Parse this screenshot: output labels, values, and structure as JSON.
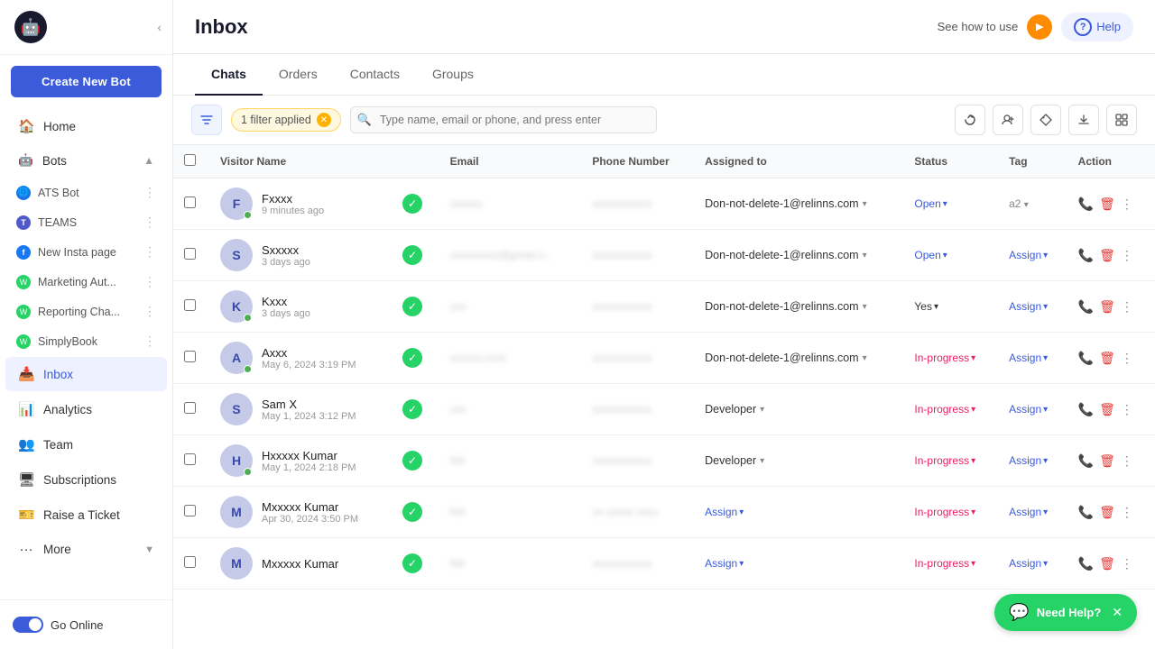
{
  "sidebar": {
    "logo_char": "🤖",
    "create_bot_label": "Create New Bot",
    "nav_items": [
      {
        "id": "home",
        "label": "Home",
        "icon": "🏠"
      },
      {
        "id": "bots",
        "label": "Bots",
        "icon": "🤖",
        "expandable": true
      },
      {
        "id": "inbox",
        "label": "Inbox",
        "icon": "📥",
        "active": true
      },
      {
        "id": "analytics",
        "label": "Analytics",
        "icon": "📊"
      },
      {
        "id": "team",
        "label": "Team",
        "icon": "👥"
      },
      {
        "id": "subscriptions",
        "label": "Subscriptions",
        "icon": "🖥"
      },
      {
        "id": "raise-ticket",
        "label": "Raise a Ticket",
        "icon": "🎫"
      },
      {
        "id": "more",
        "label": "More",
        "icon": "···"
      }
    ],
    "bots": [
      {
        "name": "ATS Bot",
        "badge_type": "blue",
        "badge_char": "🌐"
      },
      {
        "name": "TEAMS",
        "badge_type": "teams",
        "badge_char": "T"
      },
      {
        "name": "New Insta page",
        "badge_type": "fb",
        "badge_char": "f"
      },
      {
        "name": "Marketing Aut...",
        "badge_type": "wa",
        "badge_char": "W"
      },
      {
        "name": "Reporting Cha...",
        "badge_type": "wa",
        "badge_char": "W"
      },
      {
        "name": "SimplyBook",
        "badge_type": "wa",
        "badge_char": "W"
      }
    ],
    "go_online_label": "Go Online"
  },
  "header": {
    "title": "Inbox",
    "see_how_label": "See how to use",
    "help_label": "Help",
    "help_icon": "?"
  },
  "tabs": [
    {
      "id": "chats",
      "label": "Chats",
      "active": true
    },
    {
      "id": "orders",
      "label": "Orders"
    },
    {
      "id": "contacts",
      "label": "Contacts"
    },
    {
      "id": "groups",
      "label": "Groups"
    }
  ],
  "toolbar": {
    "filter_applied": "1 filter applied",
    "search_placeholder": "Type name, email or phone, and press enter"
  },
  "table": {
    "headers": [
      "",
      "Visitor Name",
      "",
      "Email",
      "Phone Number",
      "Assigned to",
      "Status",
      "Tag",
      "Action"
    ],
    "rows": [
      {
        "avatar_char": "F",
        "online": true,
        "visitor_name": "Fxxxx",
        "time": "9 minutes ago",
        "email": "xxxxxx",
        "phone": "xxxxxxxxxxx",
        "assigned": "Don-not-delete-1@relinns.com",
        "status": "Open",
        "status_type": "open",
        "tag": "a2"
      },
      {
        "avatar_char": "S",
        "online": false,
        "visitor_name": "Sxxxxx",
        "time": "3 days ago",
        "email": "xxxxxxxxx@gmail.x...",
        "phone": "xxxxxxxxxxx",
        "assigned": "Don-not-delete-1@relinns.com",
        "status": "Open",
        "status_type": "open",
        "tag": "Assign"
      },
      {
        "avatar_char": "K",
        "online": true,
        "visitor_name": "Kxxx",
        "time": "3 days ago",
        "email": "xxx",
        "phone": "xxxxxxxxxxx",
        "assigned": "Don-not-delete-1@relinns.com",
        "status": "Yes",
        "status_type": "yes",
        "tag": "Assign"
      },
      {
        "avatar_char": "A",
        "online": true,
        "visitor_name": "Axxx",
        "time": "May 6, 2024 3:19 PM",
        "email": "xxxxxx.com",
        "phone": "xxxxxxxxxxx",
        "assigned": "Don-not-delete-1@relinns.com",
        "status": "In-progress",
        "status_type": "inprogress",
        "tag": "Assign"
      },
      {
        "avatar_char": "S",
        "online": false,
        "visitor_name": "Sam X",
        "time": "May 1, 2024 3:12 PM",
        "email": "xxx",
        "phone": "xxxxxxxxxxx",
        "assigned": "Developer",
        "status": "In-progress",
        "status_type": "inprogress",
        "tag": "Assign"
      },
      {
        "avatar_char": "H",
        "online": true,
        "visitor_name": "Hxxxxx Kumar",
        "time": "May 1, 2024 2:18 PM",
        "email": "NA",
        "phone": "xxxxxxxxxxx",
        "assigned": "Developer",
        "status": "In-progress",
        "status_type": "inprogress",
        "tag": "Assign"
      },
      {
        "avatar_char": "M",
        "online": false,
        "visitor_name": "Mxxxxx Kumar",
        "time": "Apr 30, 2024 3:50 PM",
        "email": "NA",
        "phone": "xx xxxxx xxxx",
        "assigned": "Assign",
        "status": "In-progress",
        "status_type": "inprogress",
        "tag": "Assign"
      },
      {
        "avatar_char": "M",
        "online": false,
        "visitor_name": "Mxxxxx Kumar",
        "time": "",
        "email": "NA",
        "phone": "xxxxxxxxxxx",
        "assigned": "Assign",
        "status": "In-progress",
        "status_type": "inprogress",
        "tag": "Assign"
      }
    ]
  },
  "float_button": {
    "label": "Need Help?"
  }
}
